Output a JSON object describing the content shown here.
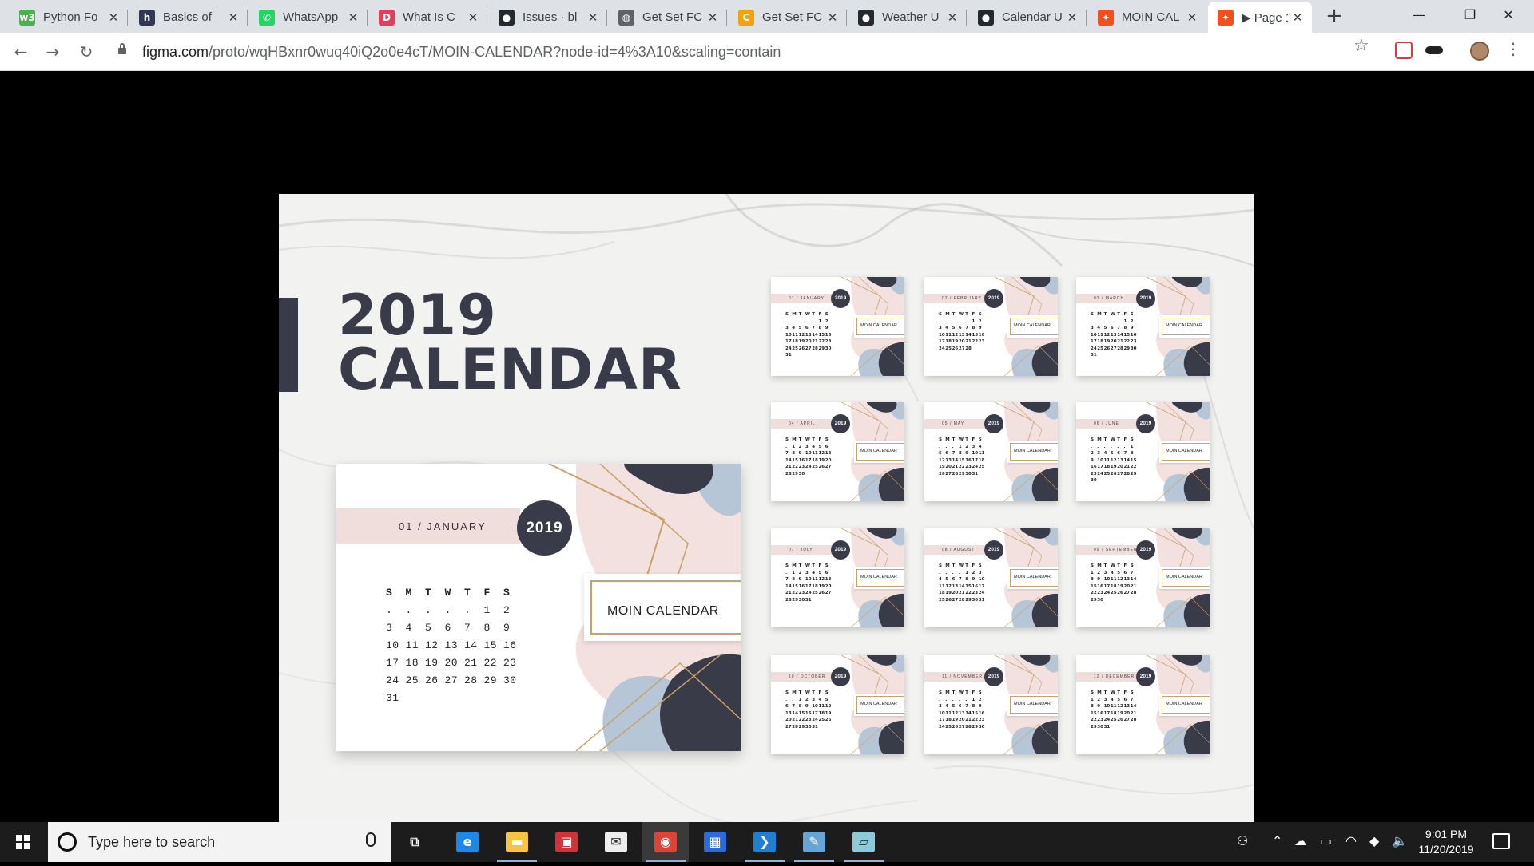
{
  "browser": {
    "tabs": [
      {
        "title": "Python Fo",
        "favicon": "w3schools-icon",
        "color": "#4caf50",
        "glyph": "w3"
      },
      {
        "title": "Basics of",
        "favicon": "h-icon",
        "color": "#323754",
        "glyph": "h"
      },
      {
        "title": "WhatsApp",
        "favicon": "whatsapp-icon",
        "color": "#25d366",
        "glyph": "✆"
      },
      {
        "title": "What Is C",
        "favicon": "d-icon",
        "color": "#e23d5f",
        "glyph": "D"
      },
      {
        "title": "Issues · bl",
        "favicon": "github-icon",
        "color": "#24292e",
        "glyph": "●"
      },
      {
        "title": "Get Set FC",
        "favicon": "globe-icon",
        "color": "#5f6368",
        "glyph": "◍"
      },
      {
        "title": "Get Set FC",
        "favicon": "c-icon",
        "color": "#f0a30a",
        "glyph": "C"
      },
      {
        "title": "Weather U",
        "favicon": "github-icon",
        "color": "#24292e",
        "glyph": "●"
      },
      {
        "title": "Calendar U",
        "favicon": "github-icon",
        "color": "#24292e",
        "glyph": "●"
      },
      {
        "title": "MOIN CAL",
        "favicon": "figma-icon",
        "color": "#f24e1e",
        "glyph": "✦"
      },
      {
        "title": "▶ Page 1",
        "favicon": "figma-icon",
        "color": "#f24e1e",
        "glyph": "✦"
      }
    ],
    "address": {
      "host": "figma.com",
      "path": "/proto/wqHBxnr0wuq40iQ2o0e4cT/MOIN-CALENDAR?node-id=4%3A10&scaling=contain"
    }
  },
  "artboard": {
    "title_line1": "2019",
    "title_line2": "CALENDAR",
    "main_card": {
      "month": "01 / JANUARY",
      "year": "2019",
      "label": "MOIN CALENDAR",
      "weekdays": [
        "S",
        "M",
        "T",
        "W",
        "T",
        "F",
        "S"
      ],
      "weeks": [
        [
          ".",
          ".",
          ".",
          ".",
          ".",
          "1",
          "2"
        ],
        [
          "3",
          "4",
          "5",
          "6",
          "7",
          "8",
          "9"
        ],
        [
          "10",
          "11",
          "12",
          "13",
          "14",
          "15",
          "16"
        ],
        [
          "17",
          "18",
          "19",
          "20",
          "21",
          "22",
          "23"
        ],
        [
          "24",
          "25",
          "26",
          "27",
          "28",
          "29",
          "30"
        ],
        [
          "31",
          "",
          "",
          "",
          "",
          "",
          ""
        ]
      ]
    },
    "thumbnails": [
      {
        "month": "01 / JANUARY",
        "year": "2019",
        "label": "MOIN CALENDAR",
        "weeks": [
          [
            ".",
            ".",
            ".",
            ".",
            ".",
            "1",
            "2"
          ],
          [
            "3",
            "4",
            "5",
            "6",
            "7",
            "8",
            "9"
          ],
          [
            "10",
            "11",
            "12",
            "13",
            "14",
            "15",
            "16"
          ],
          [
            "17",
            "18",
            "19",
            "20",
            "21",
            "22",
            "23"
          ],
          [
            "24",
            "25",
            "26",
            "27",
            "28",
            "29",
            "30"
          ],
          [
            "31",
            "",
            "",
            "",
            "",
            "",
            ""
          ]
        ]
      },
      {
        "month": "02 / FEBRUARY",
        "year": "2019",
        "label": "MOIN CALENDAR",
        "weeks": [
          [
            ".",
            ".",
            ".",
            ".",
            ".",
            "1",
            "2"
          ],
          [
            "3",
            "4",
            "5",
            "6",
            "7",
            "8",
            "9"
          ],
          [
            "10",
            "11",
            "12",
            "13",
            "14",
            "15",
            "16"
          ],
          [
            "17",
            "18",
            "19",
            "20",
            "21",
            "22",
            "23"
          ],
          [
            "24",
            "25",
            "26",
            "27",
            "28",
            "",
            ""
          ]
        ]
      },
      {
        "month": "03 / MARCH",
        "year": "2019",
        "label": "MOIN CALENDAR",
        "weeks": [
          [
            ".",
            ".",
            ".",
            ".",
            ".",
            "1",
            "2"
          ],
          [
            "3",
            "4",
            "5",
            "6",
            "7",
            "8",
            "9"
          ],
          [
            "10",
            "11",
            "12",
            "13",
            "14",
            "15",
            "16"
          ],
          [
            "17",
            "18",
            "19",
            "20",
            "21",
            "22",
            "23"
          ],
          [
            "24",
            "25",
            "26",
            "27",
            "28",
            "29",
            "30"
          ],
          [
            "31",
            "",
            "",
            "",
            "",
            "",
            ""
          ]
        ]
      },
      {
        "month": "04 / APRIL",
        "year": "2019",
        "label": "MOIN CALENDAR",
        "weeks": [
          [
            ".",
            "1",
            "2",
            "3",
            "4",
            "5",
            "6"
          ],
          [
            "7",
            "8",
            "9",
            "10",
            "11",
            "12",
            "13"
          ],
          [
            "14",
            "15",
            "16",
            "17",
            "18",
            "19",
            "20"
          ],
          [
            "21",
            "22",
            "23",
            "24",
            "25",
            "26",
            "27"
          ],
          [
            "28",
            "29",
            "30",
            "",
            "",
            "",
            ""
          ]
        ]
      },
      {
        "month": "05 / MAY",
        "year": "2019",
        "label": "MOIN CALENDAR",
        "weeks": [
          [
            ".",
            ".",
            ".",
            "1",
            "2",
            "3",
            "4"
          ],
          [
            "5",
            "6",
            "7",
            "8",
            "9",
            "10",
            "11"
          ],
          [
            "12",
            "13",
            "14",
            "15",
            "16",
            "17",
            "18"
          ],
          [
            "19",
            "20",
            "21",
            "22",
            "23",
            "24",
            "25"
          ],
          [
            "26",
            "27",
            "28",
            "29",
            "30",
            "31",
            ""
          ]
        ]
      },
      {
        "month": "06 / JUNE",
        "year": "2019",
        "label": "MOIN CALENDAR",
        "weeks": [
          [
            ".",
            ".",
            ".",
            ".",
            ".",
            ".",
            "1"
          ],
          [
            "2",
            "3",
            "4",
            "5",
            "6",
            "7",
            "8"
          ],
          [
            "9",
            "10",
            "11",
            "12",
            "13",
            "14",
            "15"
          ],
          [
            "16",
            "17",
            "18",
            "19",
            "20",
            "21",
            "22"
          ],
          [
            "23",
            "24",
            "25",
            "26",
            "27",
            "28",
            "29"
          ],
          [
            "30",
            "",
            "",
            "",
            "",
            "",
            ""
          ]
        ]
      },
      {
        "month": "07 / JULY",
        "year": "2019",
        "label": "MOIN CALENDAR",
        "weeks": [
          [
            ".",
            "1",
            "2",
            "3",
            "4",
            "5",
            "6"
          ],
          [
            "7",
            "8",
            "9",
            "10",
            "11",
            "12",
            "13"
          ],
          [
            "14",
            "15",
            "16",
            "17",
            "18",
            "19",
            "20"
          ],
          [
            "21",
            "22",
            "23",
            "24",
            "25",
            "26",
            "27"
          ],
          [
            "28",
            "29",
            "30",
            "31",
            "",
            "",
            ""
          ]
        ]
      },
      {
        "month": "08 / AUGUST",
        "year": "2019",
        "label": "MOIN CALENDAR",
        "weeks": [
          [
            ".",
            ".",
            ".",
            ".",
            "1",
            "2",
            "3"
          ],
          [
            "4",
            "5",
            "6",
            "7",
            "8",
            "9",
            "10"
          ],
          [
            "11",
            "12",
            "13",
            "14",
            "15",
            "16",
            "17"
          ],
          [
            "18",
            "19",
            "20",
            "21",
            "22",
            "23",
            "24"
          ],
          [
            "25",
            "26",
            "27",
            "28",
            "29",
            "30",
            "31"
          ]
        ]
      },
      {
        "month": "09 / SEPTEMBER",
        "year": "2019",
        "label": "MOIN CALENDAR",
        "weeks": [
          [
            "1",
            "2",
            "3",
            "4",
            "5",
            "6",
            "7"
          ],
          [
            "8",
            "9",
            "10",
            "11",
            "12",
            "13",
            "14"
          ],
          [
            "15",
            "16",
            "17",
            "18",
            "19",
            "20",
            "21"
          ],
          [
            "22",
            "23",
            "24",
            "25",
            "26",
            "27",
            "28"
          ],
          [
            "29",
            "30",
            "",
            "",
            "",
            "",
            ""
          ]
        ]
      },
      {
        "month": "10 / OCTOBER",
        "year": "2019",
        "label": "MOIN CALENDAR",
        "weeks": [
          [
            ".",
            ".",
            "1",
            "2",
            "3",
            "4",
            "5"
          ],
          [
            "6",
            "7",
            "8",
            "9",
            "10",
            "11",
            "12"
          ],
          [
            "13",
            "14",
            "15",
            "16",
            "17",
            "18",
            "19"
          ],
          [
            "20",
            "21",
            "22",
            "23",
            "24",
            "25",
            "26"
          ],
          [
            "27",
            "28",
            "29",
            "30",
            "31",
            "",
            ""
          ]
        ]
      },
      {
        "month": "11 / NOVEMBER",
        "year": "2019",
        "label": "MOIN CALENDAR",
        "weeks": [
          [
            ".",
            ".",
            ".",
            ".",
            ".",
            "1",
            "2"
          ],
          [
            "3",
            "4",
            "5",
            "6",
            "7",
            "8",
            "9"
          ],
          [
            "10",
            "11",
            "12",
            "13",
            "14",
            "15",
            "16"
          ],
          [
            "17",
            "18",
            "19",
            "20",
            "21",
            "22",
            "23"
          ],
          [
            "24",
            "25",
            "26",
            "27",
            "28",
            "29",
            "30"
          ]
        ]
      },
      {
        "month": "12 / DECEMBER",
        "year": "2019",
        "label": "MOIN CALENDAR",
        "weeks": [
          [
            "1",
            "2",
            "3",
            "4",
            "5",
            "6",
            "7"
          ],
          [
            "8",
            "9",
            "10",
            "11",
            "12",
            "13",
            "14"
          ],
          [
            "15",
            "16",
            "17",
            "18",
            "19",
            "20",
            "21"
          ],
          [
            "22",
            "23",
            "24",
            "25",
            "26",
            "27",
            "28"
          ],
          [
            "29",
            "30",
            "31",
            "",
            "",
            "",
            ""
          ]
        ]
      }
    ]
  },
  "taskbar": {
    "search_placeholder": "Type here to search",
    "apps": [
      {
        "name": "task-view-icon",
        "color": "#1c1c1c",
        "glyph": "⧉"
      },
      {
        "name": "edge-icon",
        "color": "#1e88e5",
        "glyph": "e"
      },
      {
        "name": "file-explorer-icon",
        "color": "#f6c343",
        "glyph": "▬"
      },
      {
        "name": "gift-app-icon",
        "color": "#d0323a",
        "glyph": "▣"
      },
      {
        "name": "mail-icon",
        "color": "#eeeeee",
        "glyph": "✉"
      },
      {
        "name": "chrome-icon",
        "color": "#db4437",
        "glyph": "◉"
      },
      {
        "name": "store-icon",
        "color": "#2b6cd8",
        "glyph": "▦"
      },
      {
        "name": "vscode-icon",
        "color": "#1f7fd1",
        "glyph": "❯"
      },
      {
        "name": "paint-icon",
        "color": "#66a5d6",
        "glyph": "✎"
      },
      {
        "name": "notes-app-icon",
        "color": "#8ec9d8",
        "glyph": "▱"
      }
    ],
    "time": "9:01 PM",
    "date": "11/20/2019"
  }
}
